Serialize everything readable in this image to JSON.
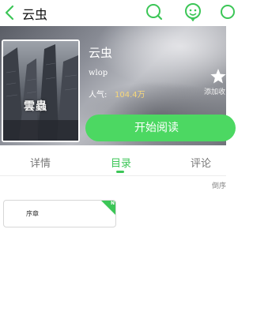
{
  "topbar": {
    "title": "云虫",
    "icons": [
      "back-arrow-icon",
      "search-icon",
      "customer-service-icon",
      "more-icon"
    ],
    "accent": "#3cc657"
  },
  "book": {
    "cover_text": "雲蟲",
    "name": "云虫",
    "author": "wlop",
    "popularity_label": "人气:",
    "popularity_value": "104.4万",
    "add_to_shelf": "添加收",
    "read_button": "开始阅读"
  },
  "tabs": [
    {
      "label": "详情",
      "active": false
    },
    {
      "label": "目录",
      "active": true
    },
    {
      "label": "评论",
      "active": false
    }
  ],
  "catalog": {
    "sort_label": "倒序",
    "chapters": [
      {
        "label": "序章",
        "badge": "N"
      }
    ]
  },
  "colors": {
    "green": "#4cd862",
    "popularity": "#f6d77a"
  }
}
